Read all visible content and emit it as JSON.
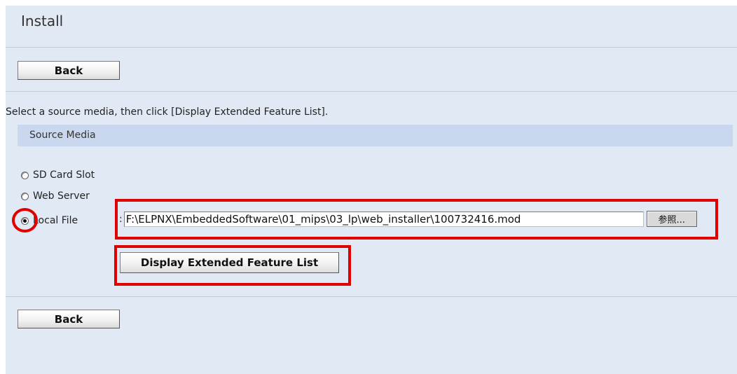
{
  "page": {
    "title": "Install",
    "back_label": "Back",
    "instruction": "Select a source media, then click [Display Extended Feature List].",
    "section_title": "Source Media"
  },
  "options": [
    {
      "label": "SD Card Slot",
      "checked": false
    },
    {
      "label": "Web Server",
      "checked": false
    },
    {
      "label": "Local File",
      "checked": true
    }
  ],
  "local_file": {
    "separator": ":",
    "path": "F:\\ELPNX\\EmbeddedSoftware\\01_mips\\03_lp\\web_installer\\100732416.mod",
    "browse_label": "参照..."
  },
  "display_button_label": "Display Extended Feature List",
  "colors": {
    "panel_bg": "#e1eaf4",
    "section_bg": "#c9d8ee",
    "highlight": "#e00000"
  }
}
